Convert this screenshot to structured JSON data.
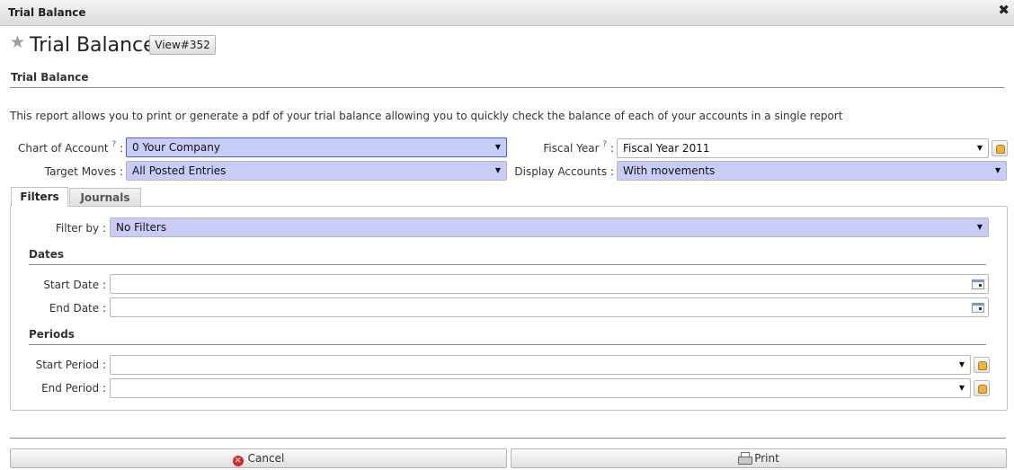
{
  "window": {
    "title": "Trial Balance",
    "close_glyph": "✖"
  },
  "header": {
    "star_glyph": "★",
    "title": "Trial Balance",
    "view_button": "View#352"
  },
  "form": {
    "section_title": "Trial Balance",
    "description": "This report allows you to print or generate a pdf of your trial balance allowing you to quickly check the balance of each of your accounts in a single report",
    "chart_of_account": {
      "label": "Chart of Account",
      "help": "?",
      "suffix": ":",
      "value": "0 Your Company"
    },
    "fiscal_year": {
      "label": "Fiscal Year",
      "help": "?",
      "suffix": ":",
      "value": "Fiscal Year 2011"
    },
    "target_moves": {
      "label": "Target Moves :",
      "value": "All Posted Entries"
    },
    "display_accounts": {
      "label": "Display Accounts :",
      "value": "With movements"
    }
  },
  "tabs": [
    {
      "label": "Filters",
      "active": true
    },
    {
      "label": "Journals",
      "active": false
    }
  ],
  "filters": {
    "filter_by": {
      "label": "Filter by :",
      "value": "No Filters"
    },
    "dates_title": "Dates",
    "start_date": {
      "label": "Start Date :",
      "value": ""
    },
    "end_date": {
      "label": "End Date :",
      "value": ""
    },
    "periods_title": "Periods",
    "start_period": {
      "label": "Start Period :",
      "value": ""
    },
    "end_period": {
      "label": "End Period :",
      "value": ""
    }
  },
  "footer": {
    "cancel_label": "Cancel",
    "print_label": "Print"
  },
  "icons": {
    "caret": "▼",
    "cancel": "✕"
  },
  "colors": {
    "required_field_bg": "#c8cdf7",
    "cancel_icon": "#d22a2a",
    "search_icon": "#f0b33a"
  }
}
